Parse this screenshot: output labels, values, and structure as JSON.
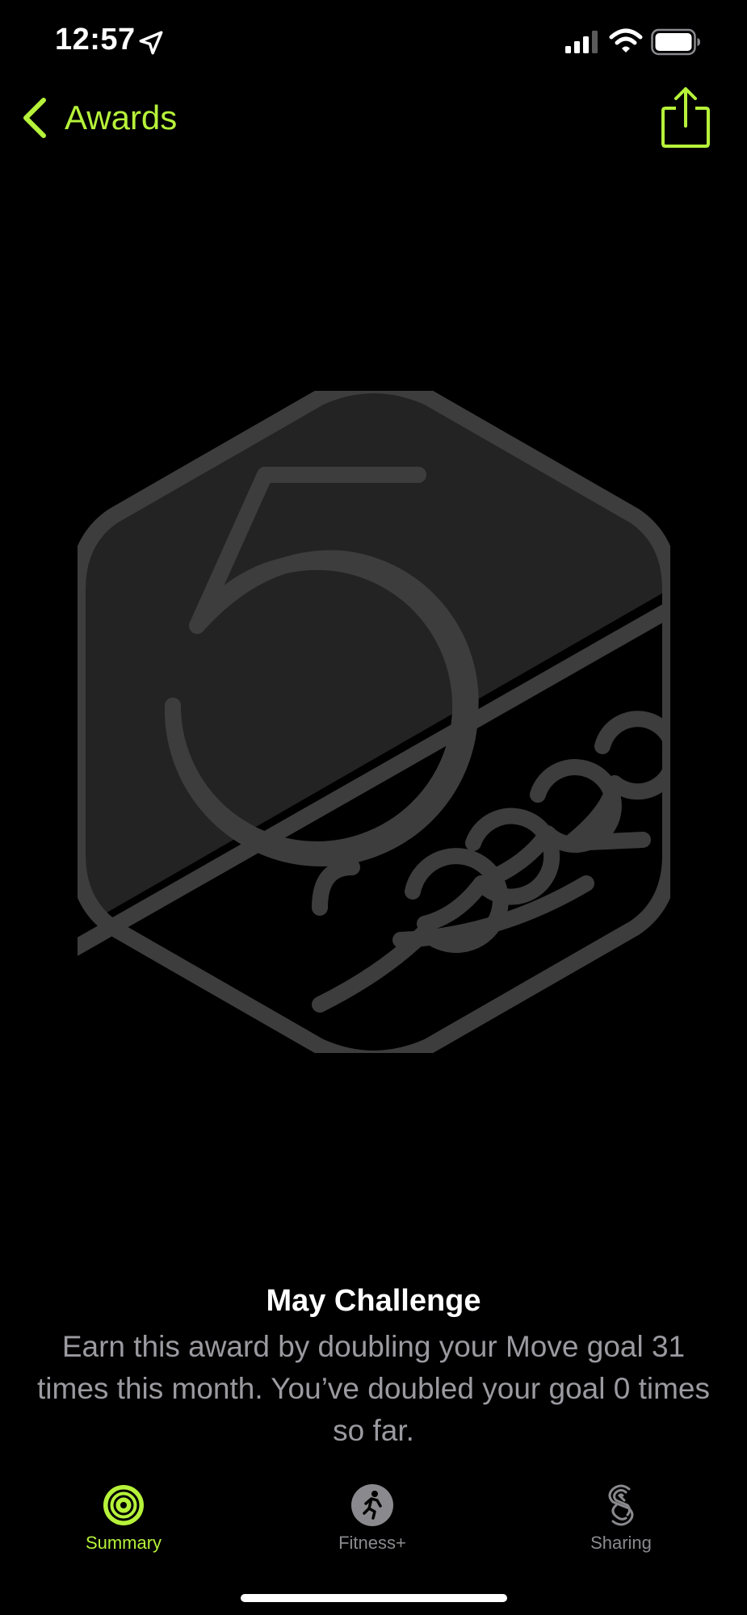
{
  "status_bar": {
    "time": "12:57",
    "icons": [
      "location-arrow-icon",
      "cellular-signal-icon",
      "wifi-icon",
      "battery-icon"
    ]
  },
  "nav": {
    "back_label": "Awards",
    "share_icon": "share-icon"
  },
  "colors": {
    "accent": "#b6f23a",
    "badge_fill": "#232323",
    "badge_stroke": "#3d3d3d",
    "description_text": "#9a9aa0",
    "inactive_tab": "#8a8a8e"
  },
  "badge": {
    "icon": "may-challenge-2022-badge-icon",
    "state": "locked"
  },
  "award": {
    "title": "May Challenge",
    "description": "Earn this award by doubling your Move goal 31 times this month. You’ve doubled your goal 0 times so far."
  },
  "tabs": [
    {
      "label": "Summary",
      "icon": "activity-rings-icon",
      "active": true
    },
    {
      "label": "Fitness+",
      "icon": "runner-icon",
      "active": false
    },
    {
      "label": "Sharing",
      "icon": "sharing-icon",
      "active": false
    }
  ]
}
